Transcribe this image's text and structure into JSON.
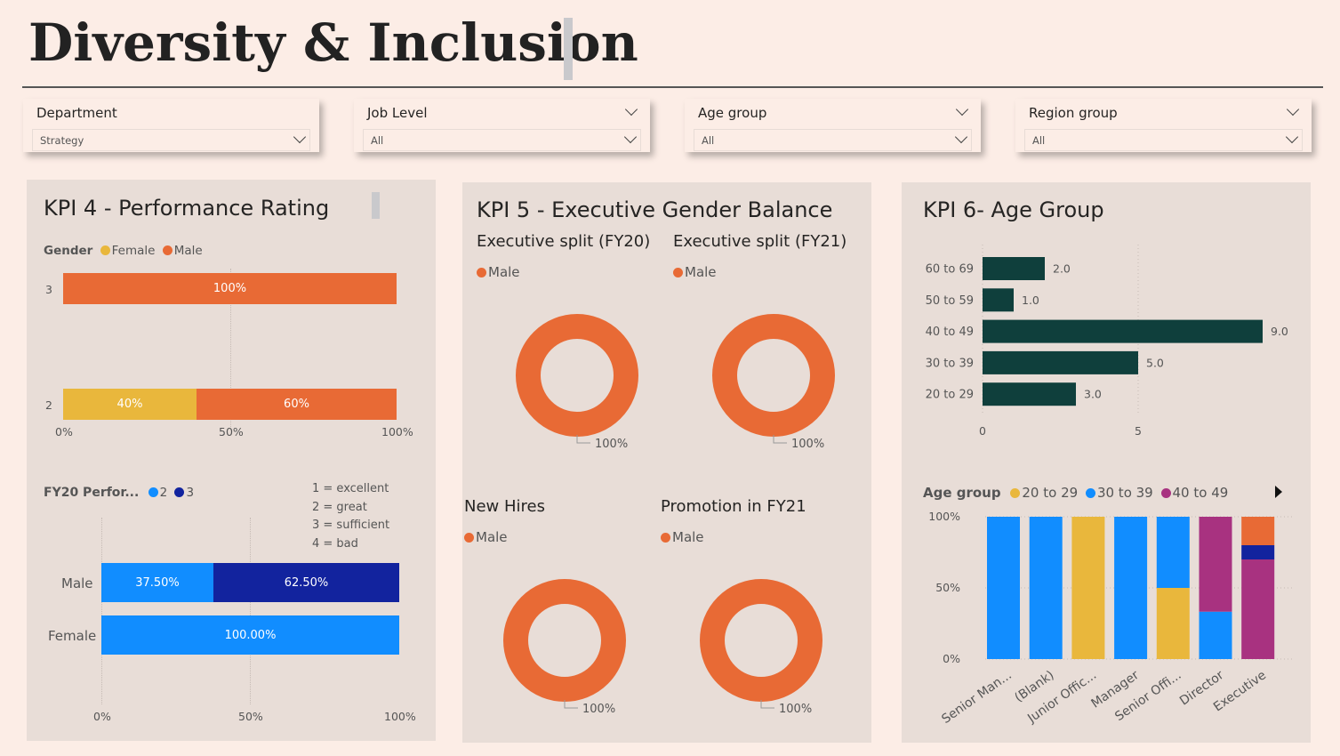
{
  "header": {
    "title": "Diversity & Inclusion"
  },
  "slicers": [
    {
      "label": "Department",
      "value": "Strategy"
    },
    {
      "label": "Job Level",
      "value": "All"
    },
    {
      "label": "Age group",
      "value": "All"
    },
    {
      "label": "Region group",
      "value": "All"
    }
  ],
  "colors": {
    "female": "#e9b73c",
    "male": "#e86a35",
    "rating2": "#118dff",
    "rating3": "#12239e",
    "age_bar": "#0f3f3c",
    "age20": "#e9b73c",
    "age30": "#118dff",
    "age40": "#a83280"
  },
  "kpi4": {
    "title": "KPI 4 - Performance Rating",
    "legend_title": "Gender",
    "legend": [
      "Female",
      "Male"
    ],
    "bars": [
      {
        "category": "3",
        "segments": [
          {
            "label": "100%"
          }
        ]
      },
      {
        "category": "2",
        "segments": [
          {
            "label": "40%"
          },
          {
            "label": "60%"
          }
        ]
      }
    ],
    "axis_ticks": [
      "0%",
      "50%",
      "100%"
    ],
    "legend2_title": "FY20 Perfor...",
    "legend2": [
      "2",
      "3"
    ],
    "key": [
      "1 = excellent",
      "2 = great",
      "3 = sufficient",
      "4 = bad"
    ],
    "bars2": [
      {
        "category": "Male",
        "segments": [
          {
            "label": "37.50%"
          },
          {
            "label": "62.50%"
          }
        ]
      },
      {
        "category": "Female",
        "segments": [
          {
            "label": "100.00%"
          }
        ]
      }
    ],
    "axis2_ticks": [
      "0%",
      "50%",
      "100%"
    ]
  },
  "kpi5": {
    "title": "KPI 5 - Executive Gender Balance",
    "donuts": [
      {
        "title": "Executive split (FY20)",
        "legend": "Male",
        "label": "100%"
      },
      {
        "title": "Executive split (FY21)",
        "legend": "Male",
        "label": "100%"
      },
      {
        "title": "New Hires",
        "legend": "Male",
        "label": "100%"
      },
      {
        "title": "Promotion in FY21",
        "legend": "Male",
        "label": "100%"
      }
    ]
  },
  "kpi6": {
    "title": "KPI 6- Age Group",
    "axis_ticks": [
      "0",
      "5"
    ],
    "legend_title": "Age group",
    "legend": [
      "20 to 29",
      "30 to 39",
      "40 to 49"
    ],
    "y_ticks": [
      "100%",
      "50%",
      "0%"
    ]
  },
  "chart_data": [
    {
      "type": "bar",
      "title": "KPI 4 - Performance Rating",
      "orientation": "horizontal",
      "stacked": "100%",
      "categories": [
        "3",
        "2"
      ],
      "series": [
        {
          "name": "Female",
          "values": [
            0,
            40
          ]
        },
        {
          "name": "Male",
          "values": [
            100,
            60
          ]
        }
      ],
      "xlim": [
        0,
        100
      ]
    },
    {
      "type": "bar",
      "orientation": "horizontal",
      "stacked": "100%",
      "categories": [
        "Male",
        "Female"
      ],
      "series": [
        {
          "name": "2",
          "values": [
            37.5,
            100
          ]
        },
        {
          "name": "3",
          "values": [
            62.5,
            0
          ]
        }
      ],
      "xlim": [
        0,
        100
      ]
    },
    {
      "type": "pie",
      "title": "Executive split (FY20)",
      "categories": [
        "Male"
      ],
      "values": [
        100
      ]
    },
    {
      "type": "pie",
      "title": "Executive split (FY21)",
      "categories": [
        "Male"
      ],
      "values": [
        100
      ]
    },
    {
      "type": "pie",
      "title": "New Hires",
      "categories": [
        "Male"
      ],
      "values": [
        100
      ]
    },
    {
      "type": "pie",
      "title": "Promotion in FY21",
      "categories": [
        "Male"
      ],
      "values": [
        100
      ]
    },
    {
      "type": "bar",
      "title": "KPI 6- Age Group",
      "orientation": "horizontal",
      "categories": [
        "60 to 69",
        "50 to 59",
        "40 to 49",
        "30 to 39",
        "20 to 29"
      ],
      "values": [
        2.0,
        1.0,
        9.0,
        5.0,
        3.0
      ],
      "data_labels": [
        "2.0",
        "1.0",
        "9.0",
        "5.0",
        "3.0"
      ],
      "xlim": [
        0,
        10
      ]
    },
    {
      "type": "bar",
      "stacked": "100%",
      "categories": [
        "Senior Man...",
        "(Blank)",
        "Junior Offic...",
        "Manager",
        "Senior Offi...",
        "Director",
        "Executive"
      ],
      "series": [
        {
          "name": "20 to 29",
          "values": [
            0,
            0,
            100,
            0,
            50,
            0,
            0
          ]
        },
        {
          "name": "30 to 39",
          "values": [
            100,
            100,
            0,
            100,
            50,
            33.3,
            0
          ]
        },
        {
          "name": "40 to 49",
          "values": [
            0,
            0,
            0,
            0,
            0,
            66.7,
            70
          ]
        }
      ],
      "ylim": [
        0,
        100
      ]
    }
  ]
}
